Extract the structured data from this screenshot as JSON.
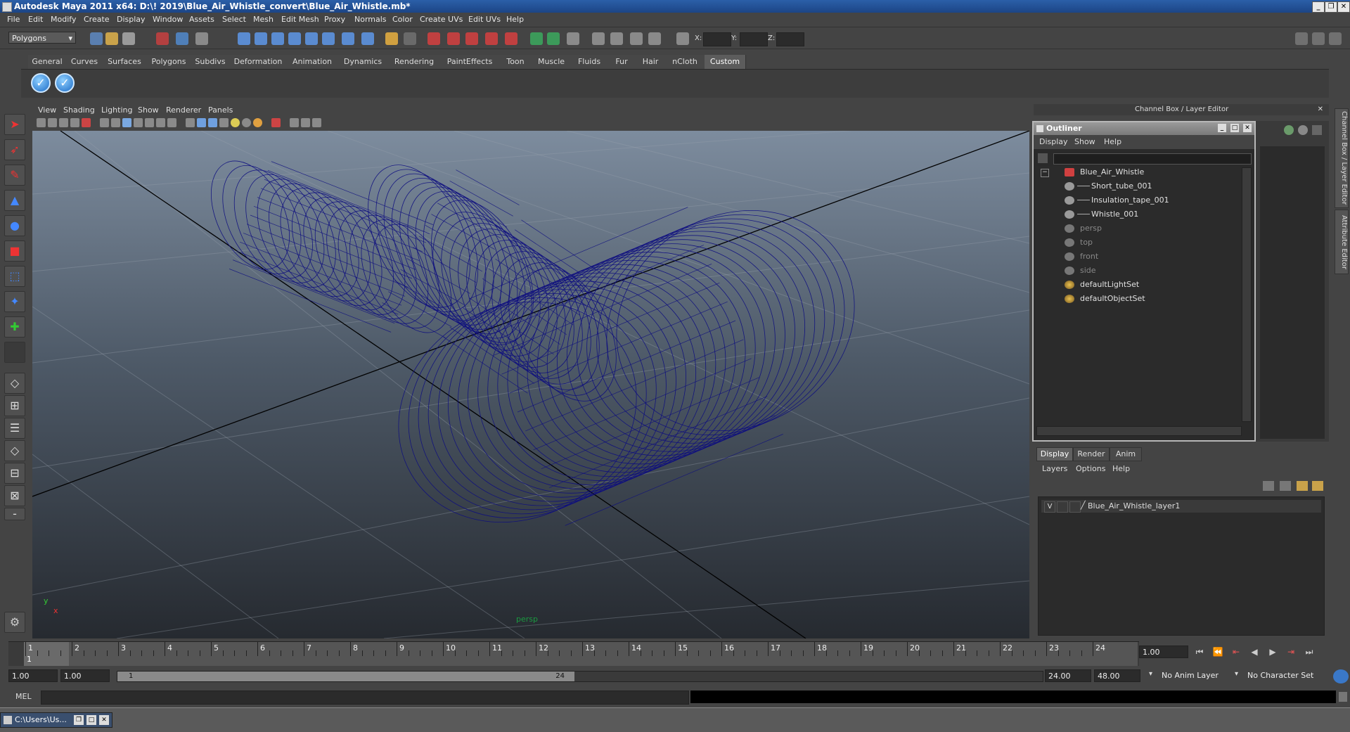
{
  "window": {
    "title": "Autodesk Maya 2011 x64: D:\\! 2019\\Blue_Air_Whistle_convert\\Blue_Air_Whistle.mb*",
    "btn_minimize": "_",
    "btn_restore": "❐",
    "btn_close": "✕"
  },
  "menubar": [
    "File",
    "Edit",
    "Modify",
    "Create",
    "Display",
    "Window",
    "Assets",
    "Select",
    "Mesh",
    "Edit Mesh",
    "Proxy",
    "Normals",
    "Color",
    "Create UVs",
    "Edit UVs",
    "Help"
  ],
  "status_line": {
    "menu_set": "Polygons",
    "x_label": "X:",
    "y_label": "Y:",
    "z_label": "Z:"
  },
  "shelf": {
    "tabs": [
      "General",
      "Curves",
      "Surfaces",
      "Polygons",
      "Subdivs",
      "Deformation",
      "Animation",
      "Dynamics",
      "Rendering",
      "PaintEffects",
      "Toon",
      "Muscle",
      "Fluids",
      "Fur",
      "Hair",
      "nCloth",
      "Custom"
    ],
    "active_tab": "Custom",
    "buttons": [
      "✓",
      "✓"
    ]
  },
  "viewport": {
    "menu": [
      "View",
      "Shading",
      "Lighting",
      "Show",
      "Renderer",
      "Panels"
    ],
    "camera_label": "persp",
    "axis_x": "x",
    "axis_y": "y",
    "wire_color": "#0d0d80"
  },
  "channel_box": {
    "header": "Channel Box / Layer Editor"
  },
  "outliner": {
    "title": "Outliner",
    "menu": [
      "Display",
      "Show",
      "Help"
    ],
    "items": [
      {
        "label": "Blue_Air_Whistle",
        "level": 0,
        "dim": false
      },
      {
        "label": "Short_tube_001",
        "level": 1,
        "dim": false
      },
      {
        "label": "Insulation_tape_001",
        "level": 1,
        "dim": false
      },
      {
        "label": "Whistle_001",
        "level": 1,
        "dim": false
      },
      {
        "label": "persp",
        "level": 0,
        "dim": true
      },
      {
        "label": "top",
        "level": 0,
        "dim": true
      },
      {
        "label": "front",
        "level": 0,
        "dim": true
      },
      {
        "label": "side",
        "level": 0,
        "dim": true
      },
      {
        "label": "defaultLightSet",
        "level": 0,
        "dim": false
      },
      {
        "label": "defaultObjectSet",
        "level": 0,
        "dim": false
      }
    ],
    "collapse": "−"
  },
  "layer_editor": {
    "tabs": [
      "Display",
      "Render",
      "Anim"
    ],
    "active_tab": "Display",
    "menu": [
      "Layers",
      "Options",
      "Help"
    ],
    "layer": {
      "visible": "V",
      "name": "Blue_Air_Whistle_layer1"
    }
  },
  "side_tabs": [
    "Channel Box / Layer Editor",
    "Attribute Editor"
  ],
  "timeline": {
    "ticks": [
      "1",
      "2",
      "3",
      "4",
      "5",
      "6",
      "7",
      "8",
      "9",
      "10",
      "11",
      "12",
      "13",
      "14",
      "15",
      "16",
      "17",
      "18",
      "19",
      "20",
      "21",
      "22",
      "23",
      "24"
    ],
    "current_marker": "1",
    "current_frame": "1.00"
  },
  "playback_buttons": [
    "⏮",
    "⏪",
    "⇤",
    "◀",
    "▶",
    "⇥",
    "⏭"
  ],
  "range": {
    "start": "1.00",
    "playback_start": "1.00",
    "slider_start": "1",
    "slider_end": "24",
    "playback_end": "24.00",
    "end": "48.00",
    "anim_layer": "No Anim Layer",
    "character_set": "No Character Set"
  },
  "command_line": {
    "label": "MEL"
  },
  "taskbar": {
    "item": "C:\\Users\\Us..."
  }
}
